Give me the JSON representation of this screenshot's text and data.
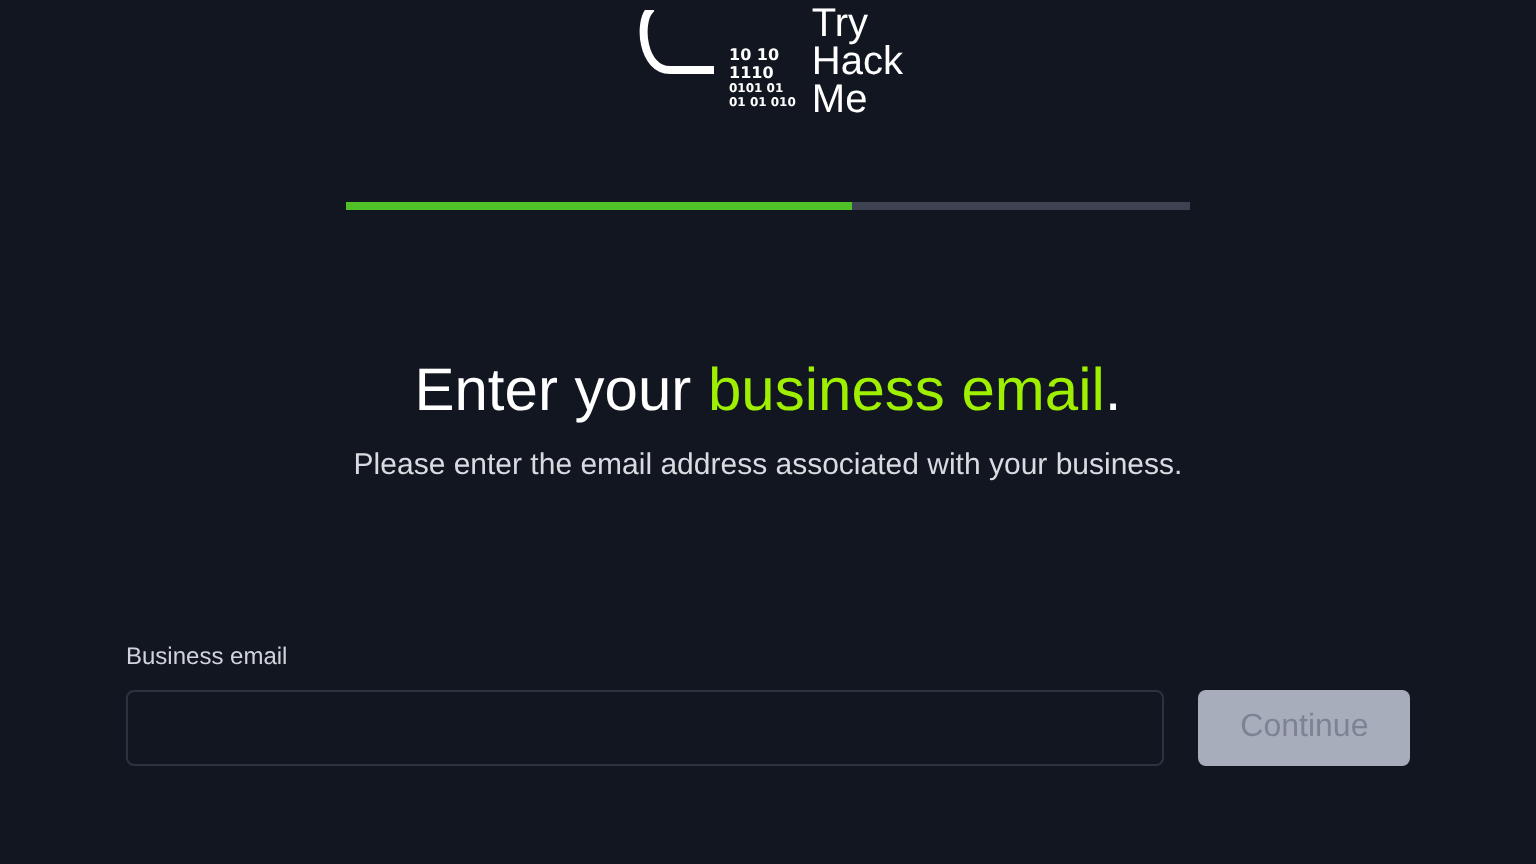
{
  "logo": {
    "binary": [
      "10 10",
      "1110",
      "0101 01",
      "01 01 010"
    ],
    "wordmark": [
      "Try",
      "Hack",
      "Me"
    ]
  },
  "progress": {
    "level": 0.6
  },
  "heading": "Enter your **business email**.",
  "subtitle": "Please enter the email address associated with your business.",
  "field": {
    "label": "Business email"
  },
  "continue_button": {
    "label": "Continue",
    "disabled": true
  }
}
